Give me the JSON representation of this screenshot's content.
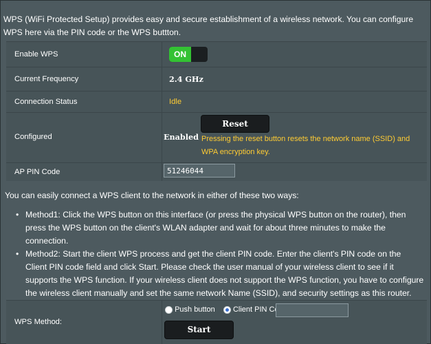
{
  "intro": "WPS (WiFi Protected Setup) provides easy and secure establishment of a wireless network. You can configure WPS here via the PIN code or the WPS buttton.",
  "enable_wps": {
    "label": "Enable WPS",
    "toggle_label": "ON",
    "state": "on"
  },
  "current_frequency": {
    "label": "Current Frequency",
    "value": "2.4 GHz"
  },
  "connection_status": {
    "label": "Connection Status",
    "value": "Idle"
  },
  "configured": {
    "label": "Configured",
    "value": "Enabled",
    "reset_button": "Reset",
    "note": "Pressing the reset button resets the network name (SSID) and WPA encryption key."
  },
  "ap_pin": {
    "label": "AP PIN Code",
    "value": "51246044"
  },
  "ways_intro": "You can easily connect a WPS client to the network in either of these two ways:",
  "methods": [
    "Method1: Click the WPS button on this interface (or press the physical WPS button on the router), then press the WPS button on the client's WLAN adapter and wait for about three minutes to make the connection.",
    "Method2: Start the client WPS process and get the client PIN code. Enter the client's PIN code on the Client PIN code field and click Start. Please check the user manual of your wireless client to see if it supports the WPS function. If your wireless client does not support the WPS function, you have to configure the wireless client manually and set the same network Name (SSID), and security settings as this router."
  ],
  "wps_method": {
    "label": "WPS Method:",
    "options": [
      "Push button",
      "Client PIN Code"
    ],
    "selected": "Client PIN Code",
    "client_pin_value": "",
    "start_button": "Start"
  },
  "colors": {
    "accent_on": "#33c233",
    "warning_text": "#ffcc33",
    "panel": "#4d5a5f",
    "row": "#475458"
  }
}
